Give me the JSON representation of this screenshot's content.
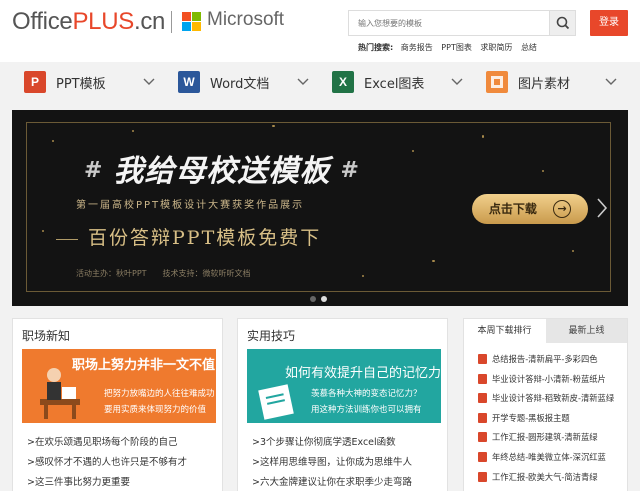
{
  "header": {
    "logo_prefix": "Office",
    "logo_plus": "PLUS",
    "logo_suffix": ".cn",
    "partner": "Microsoft",
    "search_placeholder": "输入您想要的模板",
    "login_label": "登录",
    "hot_label": "热门搜索:",
    "hot_links": [
      "商务报告",
      "PPT图表",
      "求职简历",
      "总结"
    ]
  },
  "nav": [
    {
      "label": "PPT模板",
      "icon": "ppt-icon",
      "icon_text": "P",
      "color": "#d9472b"
    },
    {
      "label": "Word文档",
      "icon": "word-icon",
      "icon_text": "W",
      "color": "#2b579a"
    },
    {
      "label": "Excel图表",
      "icon": "excel-icon",
      "icon_text": "X",
      "color": "#217346"
    },
    {
      "label": "图片素材",
      "icon": "image-icon",
      "icon_text": "",
      "color": "#f08a3c"
    }
  ],
  "banner": {
    "hash": "#",
    "title": "我给母校送模板",
    "subtitle": "第一届高校PPT模板设计大赛获奖作品展示",
    "main_text": "百份答辩PPT模板免费下",
    "organizer": "活动主办：秋叶PPT",
    "support": "技术支持：微软听听文档",
    "cta_label": "点击下载",
    "cta_arrow": "→",
    "slides": 2,
    "active_slide": 2
  },
  "cards": [
    {
      "title": "职场新知",
      "image_lines": [
        "职场上努力并非一文不值",
        "把努力放嘴边的人往往难成功",
        "要用实质来体现努力的价值"
      ],
      "items": [
        ">在欢乐颂遇见职场每个阶段的自己",
        ">感叹怀才不遇的人也许只是不够有才",
        ">这三件事比努力更重要"
      ]
    },
    {
      "title": "实用技巧",
      "image_lines": [
        "如何有效提升自己的记忆力",
        "羡慕各种大神的变态记忆力？",
        "用这种方法训练你也可以拥有"
      ],
      "items": [
        ">3个步骤让你彻底学透Excel函数",
        ">这样用思维导图，让你成为思维牛人",
        ">六大金牌建议让你在求职季少走弯路"
      ]
    }
  ],
  "weekly": {
    "tabs": [
      "本周下载排行",
      "最新上线"
    ],
    "active_tab": 0,
    "items": [
      "总结报告-清新扁平-多彩四色",
      "毕业设计答辩-小清新-粉蓝纸片",
      "毕业设计答辩-稻致新皮-清新蓝绿",
      "开学专题-黑板报主题",
      "工作汇报-圆形建筑-清新蓝绿",
      "年终总结-唯美微立体-深沉红蓝",
      "工作汇报-欧美大气-简洁青绿"
    ]
  },
  "colors": {
    "brand_red": "#e8472a",
    "gold": "#d8bf86",
    "card1_bg": "#ef7a2e",
    "card2_bg": "#22a6a0"
  }
}
